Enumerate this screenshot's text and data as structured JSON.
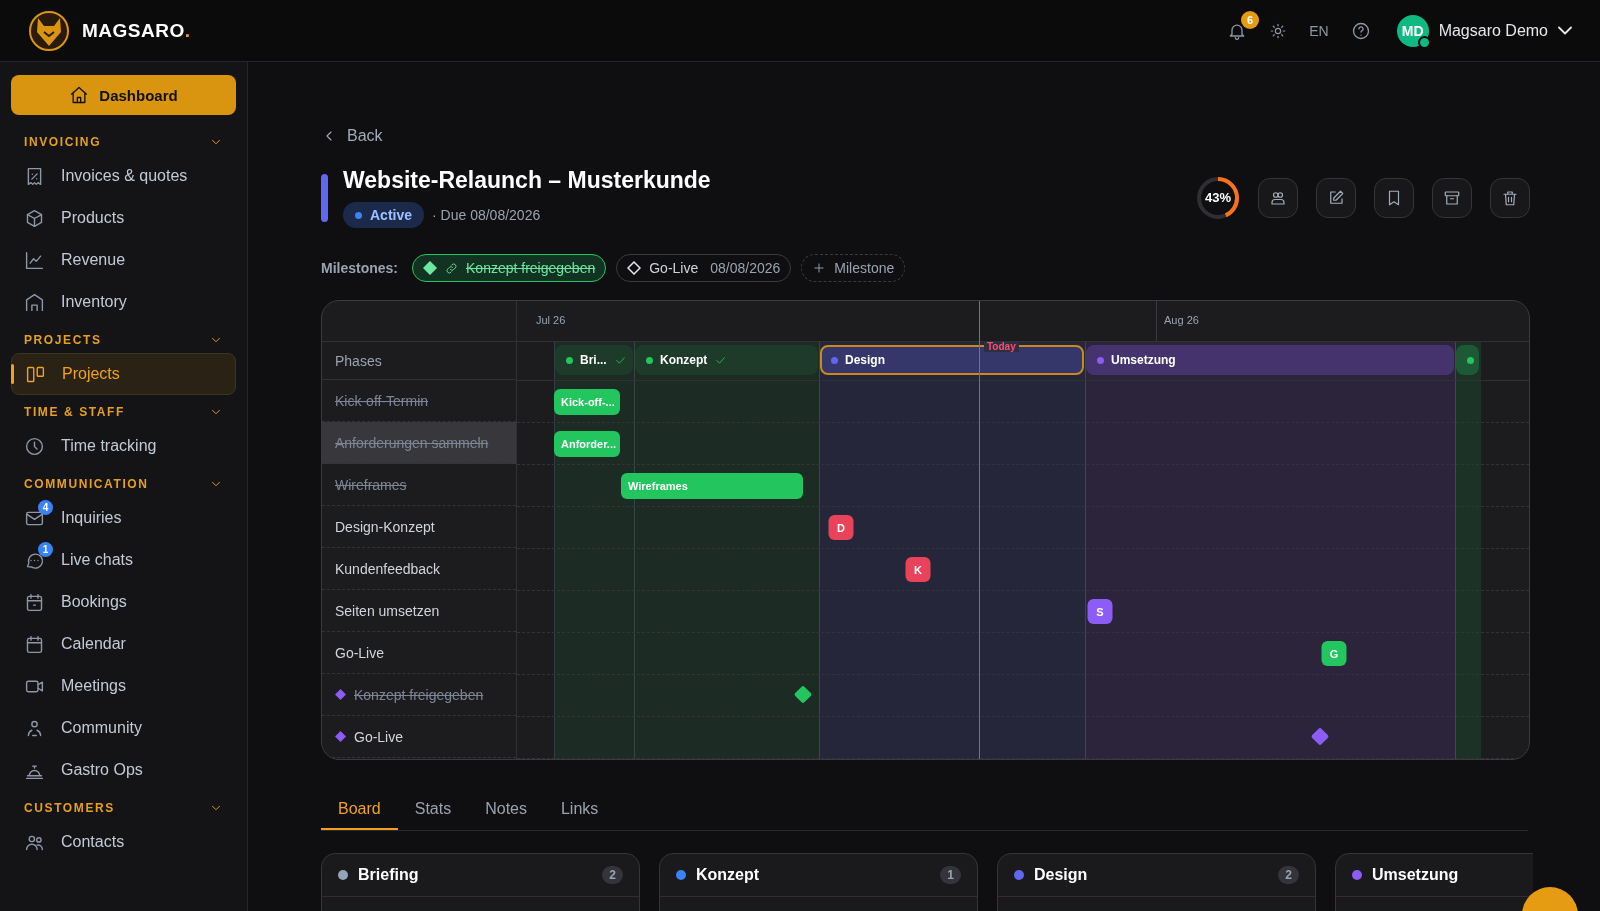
{
  "topbar": {
    "brand": {
      "name": "MAGSARO",
      "dot": "."
    },
    "notifications": "6",
    "language": "EN",
    "user": {
      "initials": "MD",
      "name": "Magsaro Demo",
      "online": true
    }
  },
  "sidebar": {
    "dashboard": "Dashboard",
    "sections": [
      {
        "title": "INVOICING",
        "expanded": true,
        "items": [
          {
            "label": "Invoices & quotes",
            "selected": false
          },
          {
            "label": "Products",
            "selected": false
          },
          {
            "label": "Revenue",
            "selected": false
          },
          {
            "label": "Inventory",
            "selected": false
          }
        ]
      },
      {
        "title": "PROJECTS",
        "expanded": true,
        "items": [
          {
            "label": "Projects",
            "selected": true
          }
        ]
      },
      {
        "title": "TIME & STAFF",
        "expanded": true,
        "items": [
          {
            "label": "Time tracking",
            "selected": false
          }
        ]
      },
      {
        "title": "COMMUNICATION",
        "expanded": true,
        "items": [
          {
            "label": "Inquiries",
            "selected": false,
            "badge": "4"
          },
          {
            "label": "Live chats",
            "selected": false,
            "badge": "1"
          },
          {
            "label": "Bookings",
            "selected": false
          },
          {
            "label": "Calendar",
            "selected": false
          },
          {
            "label": "Meetings",
            "selected": false
          },
          {
            "label": "Community",
            "selected": false
          },
          {
            "label": "Gastro Ops",
            "selected": false
          }
        ]
      },
      {
        "title": "CUSTOMERS",
        "expanded": true,
        "items": [
          {
            "label": "Contacts",
            "selected": false
          }
        ]
      }
    ]
  },
  "project": {
    "back": "Back",
    "title": "Website-Relaunch – Musterkunde",
    "color": "#6366f1",
    "status": "Active",
    "due": "· Due 08/08/2026",
    "progress": {
      "label": "43%",
      "level": 0.43
    }
  },
  "milestones": {
    "label": "Milestones:",
    "items": [
      {
        "label": "Konzept freigegeben",
        "done": true
      },
      {
        "label": "Go-Live",
        "date": "08/08/2026",
        "done": false
      }
    ],
    "add": "Milestone"
  },
  "gantt": {
    "months": [
      "Jul 26",
      "Aug 26"
    ],
    "today": "Today",
    "phases_label": "Phases",
    "phases": [
      {
        "label": "Bri...",
        "done": true,
        "selected": false,
        "color": "#22c55e"
      },
      {
        "label": "Konzept",
        "done": true,
        "selected": false,
        "color": "#22c55e"
      },
      {
        "label": "Design",
        "done": false,
        "selected": true,
        "color": "#6366f1"
      },
      {
        "label": "Umsetzung",
        "done": false,
        "selected": false,
        "color": "#8b5cf6"
      },
      {
        "done": false,
        "selected": false,
        "color": "#22c55e"
      }
    ],
    "rows": [
      {
        "label": "Kick-off-Termin",
        "kind": "task",
        "done": true,
        "selected": false,
        "bar": {
          "kind": "bar",
          "text": "Kick-off-...",
          "color": "#22c55e"
        }
      },
      {
        "label": "Anforderungen sammeln",
        "kind": "task",
        "done": true,
        "selected": true,
        "bar": {
          "kind": "bar",
          "text": "Anforder...",
          "color": "#22c55e"
        }
      },
      {
        "label": "Wireframes",
        "kind": "task",
        "done": true,
        "selected": false,
        "bar": {
          "kind": "bar",
          "text": "Wireframes",
          "color": "#22c55e"
        }
      },
      {
        "label": "Design-Konzept",
        "kind": "task",
        "done": false,
        "selected": false,
        "bar": {
          "kind": "marker",
          "text": "D",
          "color": "#e8435a"
        }
      },
      {
        "label": "Kundenfeedback",
        "kind": "task",
        "done": false,
        "selected": false,
        "bar": {
          "kind": "marker",
          "text": "K",
          "color": "#e8435a"
        }
      },
      {
        "label": "Seiten umsetzen",
        "kind": "task",
        "done": false,
        "selected": false,
        "bar": {
          "kind": "marker",
          "text": "S",
          "color": "#8b5cf6"
        }
      },
      {
        "label": "Go-Live",
        "kind": "task",
        "done": false,
        "selected": false,
        "bar": {
          "kind": "marker",
          "text": "G",
          "color": "#22c55e"
        }
      },
      {
        "label": "Konzept freigegeben",
        "kind": "milestone",
        "done": true,
        "selected": false,
        "bar": {
          "kind": "diamond",
          "color": "#22c55e"
        }
      },
      {
        "label": "Go-Live",
        "kind": "milestone",
        "done": false,
        "selected": false,
        "bar": {
          "kind": "diamond",
          "color": "#8b5cf6"
        }
      }
    ]
  },
  "tabs": [
    {
      "label": "Board",
      "selected": true
    },
    {
      "label": "Stats",
      "selected": false
    },
    {
      "label": "Notes",
      "selected": false
    },
    {
      "label": "Links",
      "selected": false
    }
  ],
  "board": [
    {
      "title": "Briefing",
      "count": "2",
      "color": "#94a3b8"
    },
    {
      "title": "Konzept",
      "count": "1",
      "color": "#3b82f6"
    },
    {
      "title": "Design",
      "count": "2",
      "color": "#6366f1"
    },
    {
      "title": "Umsetzung",
      "color": "#8b5cf6"
    }
  ]
}
